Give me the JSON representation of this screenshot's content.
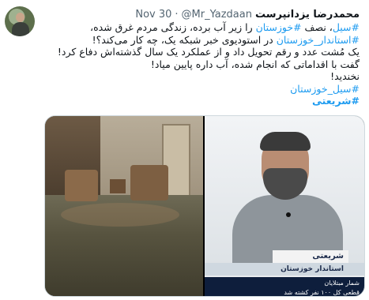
{
  "tweet": {
    "display_name": "محمدرضا یزدانپرست",
    "handle": "@Mr_Yazdaan",
    "separator": "·",
    "date": "Nov 30",
    "lines": [
      {
        "segments": [
          {
            "text": "#سیل",
            "hashtag": true
          },
          {
            "text": "، نصف ",
            "hashtag": false
          },
          {
            "text": "#خوزستان",
            "hashtag": true
          },
          {
            "text": " را زیر آب برده، زندگی مردم غرق شده،",
            "hashtag": false
          }
        ]
      },
      {
        "segments": [
          {
            "text": "#استاندار_خوزستان",
            "hashtag": true
          },
          {
            "text": " در استودیوی خبر شبکه یک، چه کار می‌کند؟!",
            "hashtag": false
          }
        ]
      },
      {
        "segments": [
          {
            "text": "یک مُشت عدد و رقم تحویل داد و از عملکرد یک سال گذشته‌اش دفاع کرد!",
            "hashtag": false
          }
        ]
      },
      {
        "segments": [
          {
            "text": "گفت با اقداماتی که انجام شده، آب داره پایین میاد!",
            "hashtag": false
          }
        ]
      },
      {
        "segments": [
          {
            "text": "نخندید!",
            "hashtag": false
          }
        ]
      },
      {
        "segments": [
          {
            "text": "#سیل_خوزستان",
            "hashtag": true
          }
        ]
      },
      {
        "segments": [
          {
            "text": "#شریعتی",
            "hashtag": true,
            "bold": true
          }
        ]
      }
    ]
  },
  "media": {
    "tv_name": "شریعتی",
    "tv_title": "استاندار خوزستان",
    "ticker_line1": "شمار مبتلایان",
    "ticker_line2": "قطعی کل ۱۰۰ نفر کشته شد"
  }
}
